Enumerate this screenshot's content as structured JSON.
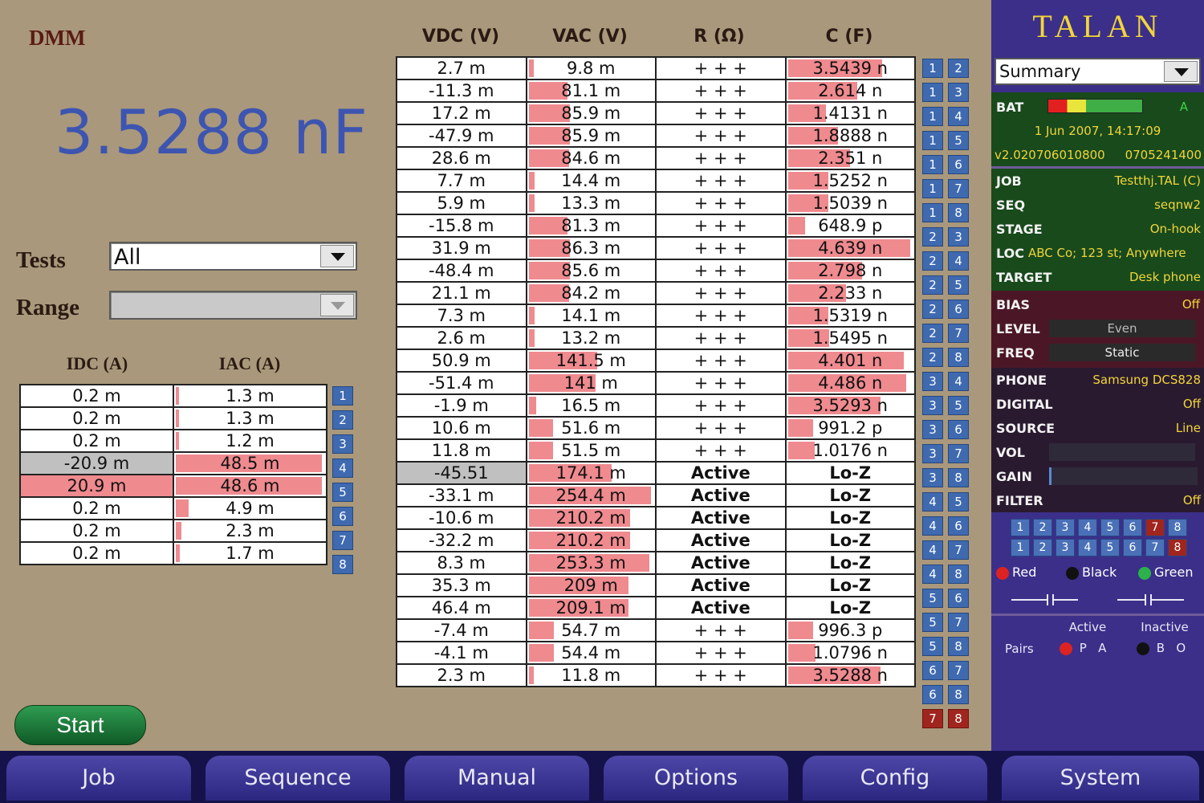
{
  "dmm": {
    "title": "DMM",
    "reading": "3.5288 nF",
    "tests_label": "Tests",
    "tests_value": "All",
    "range_label": "Range",
    "range_value": "",
    "start_label": "Start"
  },
  "current_table": {
    "headers": [
      "IDC (A)",
      "IAC (A)"
    ],
    "rows": [
      {
        "idc": "0.2 m",
        "iac": "1.3 m",
        "pair": "1",
        "bar": 0.02,
        "style": ""
      },
      {
        "idc": "0.2 m",
        "iac": "1.3 m",
        "pair": "2",
        "bar": 0.02,
        "style": ""
      },
      {
        "idc": "0.2 m",
        "iac": "1.2 m",
        "pair": "3",
        "bar": 0.02,
        "style": ""
      },
      {
        "idc": "-20.9 m",
        "iac": "48.5 m",
        "pair": "4",
        "bar": 1.0,
        "style": "grey"
      },
      {
        "idc": "20.9 m",
        "iac": "48.6 m",
        "pair": "5",
        "bar": 1.0,
        "style": "red"
      },
      {
        "idc": "0.2 m",
        "iac": "4.9 m",
        "pair": "6",
        "bar": 0.09,
        "style": ""
      },
      {
        "idc": "0.2 m",
        "iac": "2.3 m",
        "pair": "7",
        "bar": 0.04,
        "style": ""
      },
      {
        "idc": "0.2 m",
        "iac": "1.7 m",
        "pair": "8",
        "bar": 0.03,
        "style": ""
      }
    ]
  },
  "main_table": {
    "headers": [
      "VDC (V)",
      "VAC (V)",
      "R (Ω)",
      "C (F)"
    ],
    "rows": [
      {
        "vdc": "2.7 m",
        "vac": "9.8 m",
        "vbar": 0.04,
        "r": "+ + +",
        "c": "3.5439 n",
        "cbar": 0.77,
        "p1": "1",
        "p2": "2",
        "vstyle": ""
      },
      {
        "vdc": "-11.3 m",
        "vac": "81.1 m",
        "vbar": 0.32,
        "r": "+ + +",
        "c": "2.614 n",
        "cbar": 0.57,
        "p1": "1",
        "p2": "3",
        "vstyle": ""
      },
      {
        "vdc": "17.2 m",
        "vac": "85.9 m",
        "vbar": 0.34,
        "r": "+ + +",
        "c": "1.4131 n",
        "cbar": 0.31,
        "p1": "1",
        "p2": "4",
        "vstyle": ""
      },
      {
        "vdc": "-47.9 m",
        "vac": "85.9 m",
        "vbar": 0.34,
        "r": "+ + +",
        "c": "1.8888 n",
        "cbar": 0.41,
        "p1": "1",
        "p2": "5",
        "vstyle": ""
      },
      {
        "vdc": "28.6 m",
        "vac": "84.6 m",
        "vbar": 0.33,
        "r": "+ + +",
        "c": "2.351 n",
        "cbar": 0.51,
        "p1": "1",
        "p2": "6",
        "vstyle": ""
      },
      {
        "vdc": "7.7 m",
        "vac": "14.4 m",
        "vbar": 0.05,
        "r": "+ + +",
        "c": "1.5252 n",
        "cbar": 0.33,
        "p1": "1",
        "p2": "7",
        "vstyle": ""
      },
      {
        "vdc": "5.9 m",
        "vac": "13.3 m",
        "vbar": 0.05,
        "r": "+ + +",
        "c": "1.5039 n",
        "cbar": 0.33,
        "p1": "1",
        "p2": "8",
        "vstyle": ""
      },
      {
        "vdc": "-15.8 m",
        "vac": "81.3 m",
        "vbar": 0.32,
        "r": "+ + +",
        "c": "648.9 p",
        "cbar": 0.14,
        "p1": "2",
        "p2": "3",
        "vstyle": ""
      },
      {
        "vdc": "31.9 m",
        "vac": "86.3 m",
        "vbar": 0.34,
        "r": "+ + +",
        "c": "4.639 n",
        "cbar": 1.0,
        "p1": "2",
        "p2": "4",
        "vstyle": ""
      },
      {
        "vdc": "-48.4 m",
        "vac": "85.6 m",
        "vbar": 0.34,
        "r": "+ + +",
        "c": "2.798 n",
        "cbar": 0.61,
        "p1": "2",
        "p2": "5",
        "vstyle": ""
      },
      {
        "vdc": "21.1 m",
        "vac": "84.2 m",
        "vbar": 0.33,
        "r": "+ + +",
        "c": "2.233 n",
        "cbar": 0.48,
        "p1": "2",
        "p2": "6",
        "vstyle": ""
      },
      {
        "vdc": "7.3 m",
        "vac": "14.1 m",
        "vbar": 0.05,
        "r": "+ + +",
        "c": "1.5319 n",
        "cbar": 0.33,
        "p1": "2",
        "p2": "7",
        "vstyle": ""
      },
      {
        "vdc": "2.6 m",
        "vac": "13.2 m",
        "vbar": 0.05,
        "r": "+ + +",
        "c": "1.5495 n",
        "cbar": 0.34,
        "p1": "2",
        "p2": "8",
        "vstyle": ""
      },
      {
        "vdc": "50.9 m",
        "vac": "141.5 m",
        "vbar": 0.56,
        "r": "+ + +",
        "c": "4.401 n",
        "cbar": 0.95,
        "p1": "3",
        "p2": "4",
        "vstyle": ""
      },
      {
        "vdc": "-51.4 m",
        "vac": "141 m",
        "vbar": 0.55,
        "r": "+ + +",
        "c": "4.486 n",
        "cbar": 0.97,
        "p1": "3",
        "p2": "5",
        "vstyle": ""
      },
      {
        "vdc": "-1.9 m",
        "vac": "16.5 m",
        "vbar": 0.06,
        "r": "+ + +",
        "c": "3.5293 n",
        "cbar": 0.76,
        "p1": "3",
        "p2": "6",
        "vstyle": ""
      },
      {
        "vdc": "10.6 m",
        "vac": "51.6 m",
        "vbar": 0.2,
        "r": "+ + +",
        "c": "991.2 p",
        "cbar": 0.21,
        "p1": "3",
        "p2": "7",
        "vstyle": ""
      },
      {
        "vdc": "11.8 m",
        "vac": "51.5 m",
        "vbar": 0.2,
        "r": "+ + +",
        "c": "1.0176 n",
        "cbar": 0.22,
        "p1": "3",
        "p2": "8",
        "vstyle": ""
      },
      {
        "vdc": "-45.51",
        "vac": "174.1 m",
        "vbar": 0.68,
        "r": "Active",
        "c": "Lo-Z",
        "cbar": 0,
        "p1": "4",
        "p2": "5",
        "vstyle": "grey"
      },
      {
        "vdc": "-33.1 m",
        "vac": "254.4 m",
        "vbar": 1.0,
        "r": "Active",
        "c": "Lo-Z",
        "cbar": 0,
        "p1": "4",
        "p2": "6",
        "vstyle": ""
      },
      {
        "vdc": "-10.6 m",
        "vac": "210.2 m",
        "vbar": 0.83,
        "r": "Active",
        "c": "Lo-Z",
        "cbar": 0,
        "p1": "4",
        "p2": "7",
        "vstyle": ""
      },
      {
        "vdc": "-32.2 m",
        "vac": "210.2 m",
        "vbar": 0.83,
        "r": "Active",
        "c": "Lo-Z",
        "cbar": 0,
        "p1": "4",
        "p2": "8",
        "vstyle": ""
      },
      {
        "vdc": "8.3 m",
        "vac": "253.3 m",
        "vbar": 0.99,
        "r": "Active",
        "c": "Lo-Z",
        "cbar": 0,
        "p1": "5",
        "p2": "6",
        "vstyle": ""
      },
      {
        "vdc": "35.3 m",
        "vac": "209 m",
        "vbar": 0.82,
        "r": "Active",
        "c": "Lo-Z",
        "cbar": 0,
        "p1": "5",
        "p2": "7",
        "vstyle": ""
      },
      {
        "vdc": "46.4 m",
        "vac": "209.1 m",
        "vbar": 0.82,
        "r": "Active",
        "c": "Lo-Z",
        "cbar": 0,
        "p1": "5",
        "p2": "8",
        "vstyle": ""
      },
      {
        "vdc": "-7.4 m",
        "vac": "54.7 m",
        "vbar": 0.21,
        "r": "+ + +",
        "c": "996.3 p",
        "cbar": 0.21,
        "p1": "6",
        "p2": "7",
        "vstyle": ""
      },
      {
        "vdc": "-4.1 m",
        "vac": "54.4 m",
        "vbar": 0.21,
        "r": "+ + +",
        "c": "1.0796 n",
        "cbar": 0.23,
        "p1": "6",
        "p2": "8",
        "vstyle": ""
      },
      {
        "vdc": "2.3 m",
        "vac": "11.8 m",
        "vbar": 0.04,
        "r": "+ + +",
        "c": "3.5288 n",
        "cbar": 0.76,
        "p1": "7",
        "p2": "8",
        "vstyle": "",
        "pstyle": "red"
      }
    ]
  },
  "side": {
    "brand": "TALAN",
    "view": "Summary",
    "bat_label": "BAT",
    "bat_status": "A",
    "datetime": "1 Jun 2007, 14:17:09",
    "version": "v2.020706010800",
    "serial": "0705241400",
    "info": [
      {
        "label": "JOB",
        "value": "Testthj.TAL (C)"
      },
      {
        "label": "SEQ",
        "value": "seqnw2"
      },
      {
        "label": "STAGE",
        "value": "On-hook"
      },
      {
        "label": "LOC",
        "value": "ABC Co; 123 st; Anywhere"
      },
      {
        "label": "TARGET",
        "value": "Desk phone"
      }
    ],
    "bias_label": "BIAS",
    "bias_value": "Off",
    "level_label": "LEVEL",
    "level_value": "Even",
    "freq_label": "FREQ",
    "freq_value": "Static",
    "phone_label": "PHONE",
    "phone_value": "Samsung DCS828",
    "digital_label": "DIGITAL",
    "digital_value": "Off",
    "source_label": "SOURCE",
    "source_value": "Line",
    "vol_label": "VOL",
    "gain_label": "GAIN",
    "filter_label": "FILTER",
    "filter_value": "Off",
    "keys_row1": [
      "1",
      "2",
      "3",
      "4",
      "5",
      "6",
      "7",
      "8"
    ],
    "keys_row2": [
      "1",
      "2",
      "3",
      "4",
      "5",
      "6",
      "7",
      "8"
    ],
    "leads": [
      "Red",
      "Black",
      "Green"
    ],
    "active_label": "Active",
    "inactive_label": "Inactive",
    "pairs_label": "Pairs",
    "pa": [
      "P",
      "A"
    ],
    "bo": [
      "B",
      "O"
    ]
  },
  "nav": [
    "Job",
    "Sequence",
    "Manual",
    "Options",
    "Config",
    "System"
  ],
  "colors": {
    "bar": "#ef8a8f",
    "reading": "#3d55b0",
    "side_text": "#f1d53a"
  }
}
